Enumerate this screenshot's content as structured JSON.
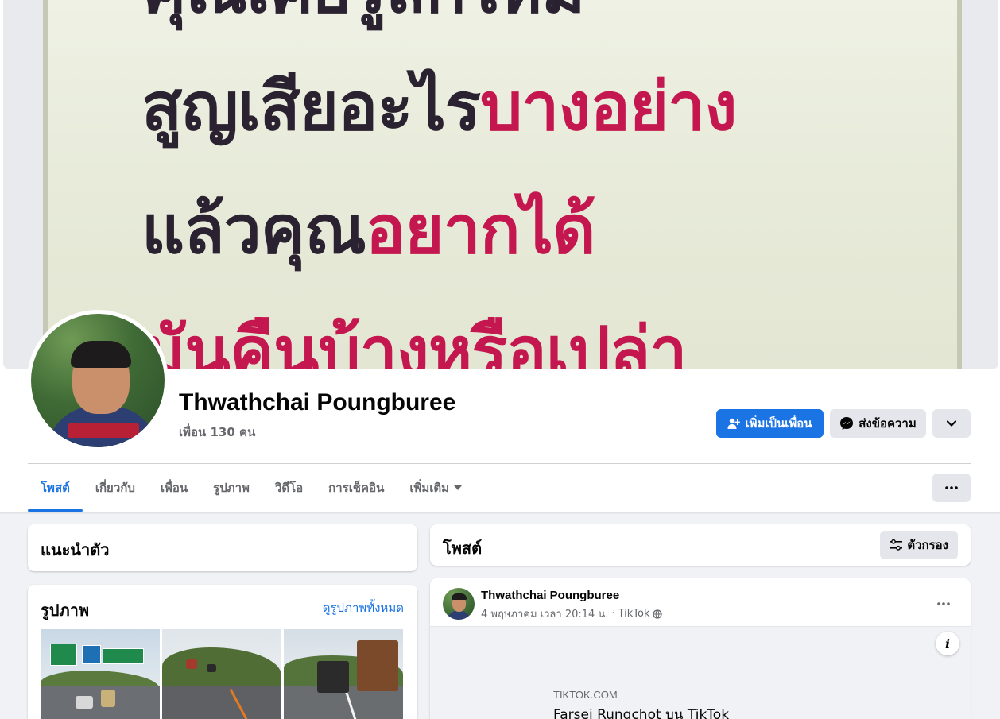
{
  "cover": {
    "line0": {
      "dark": "คุณเคยรู้สึกไหม",
      "pink": ""
    },
    "line1": {
      "dark": "สูญเสียอะไร",
      "pink": "บางอย่าง"
    },
    "line2": {
      "dark": "แล้วคุณ",
      "pink": "อยากได้"
    },
    "line3": {
      "dark": "",
      "pink": "มันคืนบ้างหรือเปล่า"
    },
    "colors": {
      "dark": "#2a2230",
      "pink": "#c5174f"
    }
  },
  "profile": {
    "name": "Thwathchai Poungburee",
    "friends": "เพื่อน 130 คน"
  },
  "actions": {
    "add_friend": "เพิ่มเป็นเพื่อน",
    "message": "ส่งข้อความ",
    "more_icon": "chevron-down-icon"
  },
  "tabs": [
    {
      "label": "โพสต์"
    },
    {
      "label": "เกี่ยวกับ"
    },
    {
      "label": "เพื่อน"
    },
    {
      "label": "รูปภาพ"
    },
    {
      "label": "วิดีโอ"
    },
    {
      "label": "การเช็คอิน"
    },
    {
      "label": "เพิ่มเติม"
    }
  ],
  "intro": {
    "title": "แนะนำตัว"
  },
  "photos": {
    "title": "รูปภาพ",
    "see_all": "ดูรูปภาพทั้งหมด"
  },
  "posts": {
    "title": "โพสต์",
    "filter": "ตัวกรอง"
  },
  "post": {
    "author": "Thwathchai Poungburee",
    "date": "4 พฤษภาคม เวลา 20:14 น.",
    "separator": "·",
    "source": "TikTok",
    "link_domain": "TIKTOK.COM",
    "link_title": "Farsei Rungchot บน TikTok"
  },
  "theme": {
    "accent": "#1b74e4",
    "bg": "#f0f2f5",
    "button_gray": "#e4e6eb"
  }
}
